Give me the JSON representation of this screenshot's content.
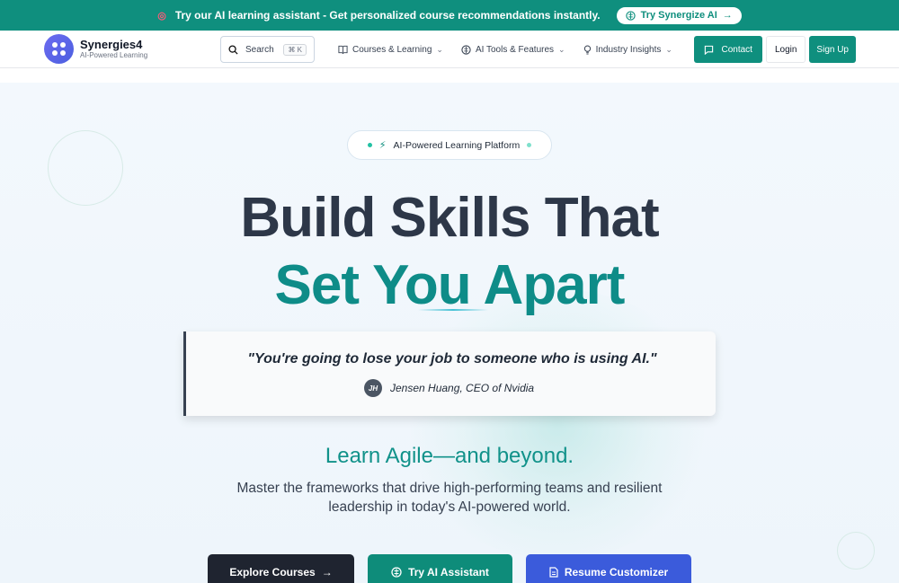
{
  "banner": {
    "icon": "target-icon",
    "text": "Try our AI learning assistant - Get personalized course recommendations instantly.",
    "button": "Try Synergize AI",
    "button_arrow": "→"
  },
  "brand": {
    "name": "Synergies4",
    "tagline": "AI-Powered Learning"
  },
  "search": {
    "label": "Search",
    "shortcut": "⌘ K"
  },
  "nav": {
    "items": [
      {
        "label": "Courses & Learning",
        "icon": "book-icon"
      },
      {
        "label": "AI Tools & Features",
        "icon": "ai-icon"
      },
      {
        "label": "Industry Insights",
        "icon": "lightbulb-icon"
      }
    ]
  },
  "actions": {
    "contact": "Contact",
    "login": "Login",
    "signup": "Sign Up"
  },
  "hero": {
    "pill": "AI-Powered Learning Platform",
    "title_line1": "Build Skills That",
    "title_line2": "Set You Apart",
    "quote": "\"You're going to lose your job to someone who is using AI.\"",
    "avatar_initials": "JH",
    "attribution": "Jensen Huang, CEO of Nvidia",
    "subtitle": "Learn Agile—and beyond.",
    "description": "Master the frameworks that drive high-performing teams and resilient leadership in today's AI-powered world.",
    "cta": [
      {
        "label": "Explore Courses",
        "trail": "→"
      },
      {
        "label": "Try AI Assistant",
        "icon": "ai-icon"
      },
      {
        "label": "Resume Customizer",
        "icon": "document-icon"
      }
    ]
  },
  "colors": {
    "brand_teal": "#0f8f7e",
    "title_dark": "#2d3748",
    "title_teal": "#0e8c88",
    "cta_blue": "#3b5bdb"
  }
}
